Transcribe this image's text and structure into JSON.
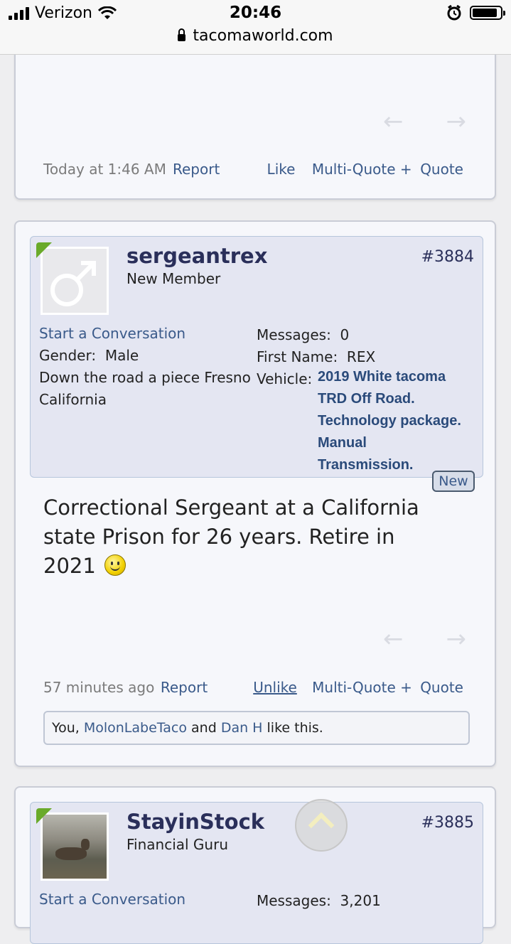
{
  "status_bar": {
    "carrier": "Verizon",
    "time": "20:46",
    "url": "tacomaworld.com"
  },
  "post1": {
    "date": "Today at 1:46 AM",
    "report": "Report",
    "like": "Like",
    "multiquote": "Multi-Quote +",
    "quote": "Quote"
  },
  "post2": {
    "username": "sergeantrex",
    "user_title": "New Member",
    "post_number": "#3884",
    "start_conversation": "Start a Conversation",
    "gender_label": "Gender:",
    "gender_value": "Male",
    "location_line1": "Down the road a piece Fresno",
    "location_line2": "California",
    "messages_label": "Messages:",
    "messages_value": "0",
    "first_name_label": "First Name:",
    "first_name_value": "REX",
    "vehicle_label": "Vehicle:",
    "vehicle_lines": [
      "2019 White tacoma",
      "TRD Off Road.",
      "Technology package.",
      "Manual",
      "Transmission."
    ],
    "new_badge": "New",
    "message_line1": "Correctional Sergeant at a California",
    "message_line2": "state Prison for 26 years. Retire in",
    "message_line3": "2021",
    "date": "57 minutes ago",
    "report": "Report",
    "unlike": "Unlike",
    "multiquote": "Multi-Quote +",
    "quote": "Quote",
    "likes_prefix": "You,",
    "likes_user1": "MolonLabeTaco",
    "likes_and": "and",
    "likes_user2": "Dan H",
    "likes_suffix": "like this."
  },
  "post3": {
    "username": "StayinStock",
    "user_title": "Financial Guru",
    "post_number": "#3885",
    "start_conversation": "Start a Conversation",
    "messages_label": "Messages:",
    "messages_value": "3,201"
  }
}
